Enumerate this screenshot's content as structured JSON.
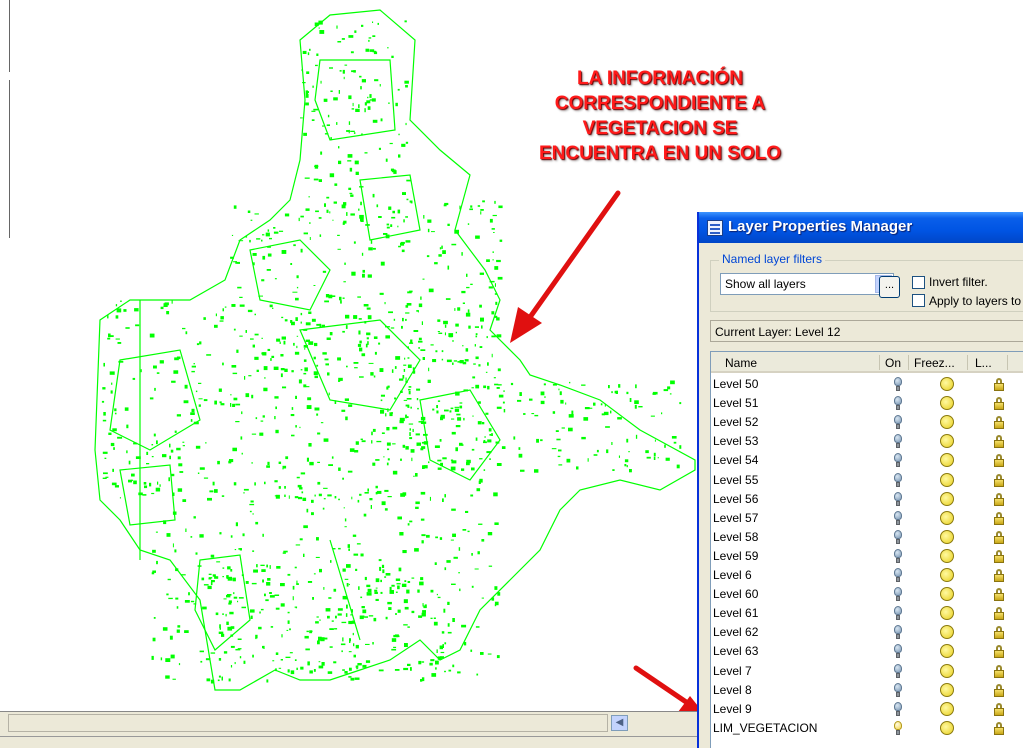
{
  "annotation": {
    "lines": [
      "LA INFORMACIÓN",
      "CORRESPONDIENTE A",
      "VEGETACION SE",
      "ENCUENTRA EN UN SOLO"
    ],
    "color": "#ff1a1a"
  },
  "map": {
    "stroke_color": "#00ff00"
  },
  "dialog": {
    "title": "Layer Properties Manager",
    "filters_legend": "Named layer filters",
    "filter_value": "Show all layers",
    "filter_button": "...",
    "invert_filter_label": "Invert filter.",
    "apply_toolbar_label": "Apply to layers to",
    "current_layer_label": "Current Layer:  Level 12",
    "columns": {
      "name": "Name",
      "on": "On",
      "freeze": "Freez...",
      "lock": "L..."
    },
    "layers": [
      {
        "name": "Level 50",
        "on": true
      },
      {
        "name": "Level 51",
        "on": true
      },
      {
        "name": "Level 52",
        "on": true
      },
      {
        "name": "Level 53",
        "on": true
      },
      {
        "name": "Level 54",
        "on": true
      },
      {
        "name": "Level 55",
        "on": true
      },
      {
        "name": "Level 56",
        "on": true
      },
      {
        "name": "Level 57",
        "on": true
      },
      {
        "name": "Level 58",
        "on": true
      },
      {
        "name": "Level 59",
        "on": true
      },
      {
        "name": "Level 6",
        "on": true
      },
      {
        "name": "Level 60",
        "on": true
      },
      {
        "name": "Level 61",
        "on": true
      },
      {
        "name": "Level 62",
        "on": true
      },
      {
        "name": "Level 63",
        "on": true
      },
      {
        "name": "Level 7",
        "on": true
      },
      {
        "name": "Level 8",
        "on": true
      },
      {
        "name": "Level 9",
        "on": true
      },
      {
        "name": "LIM_VEGETACION",
        "on": true,
        "highlight_bulb": true
      }
    ]
  },
  "colors": {
    "title_bar": "#0054e3",
    "dialog_bg": "#ece9d8",
    "legend_text": "#0046d5"
  }
}
